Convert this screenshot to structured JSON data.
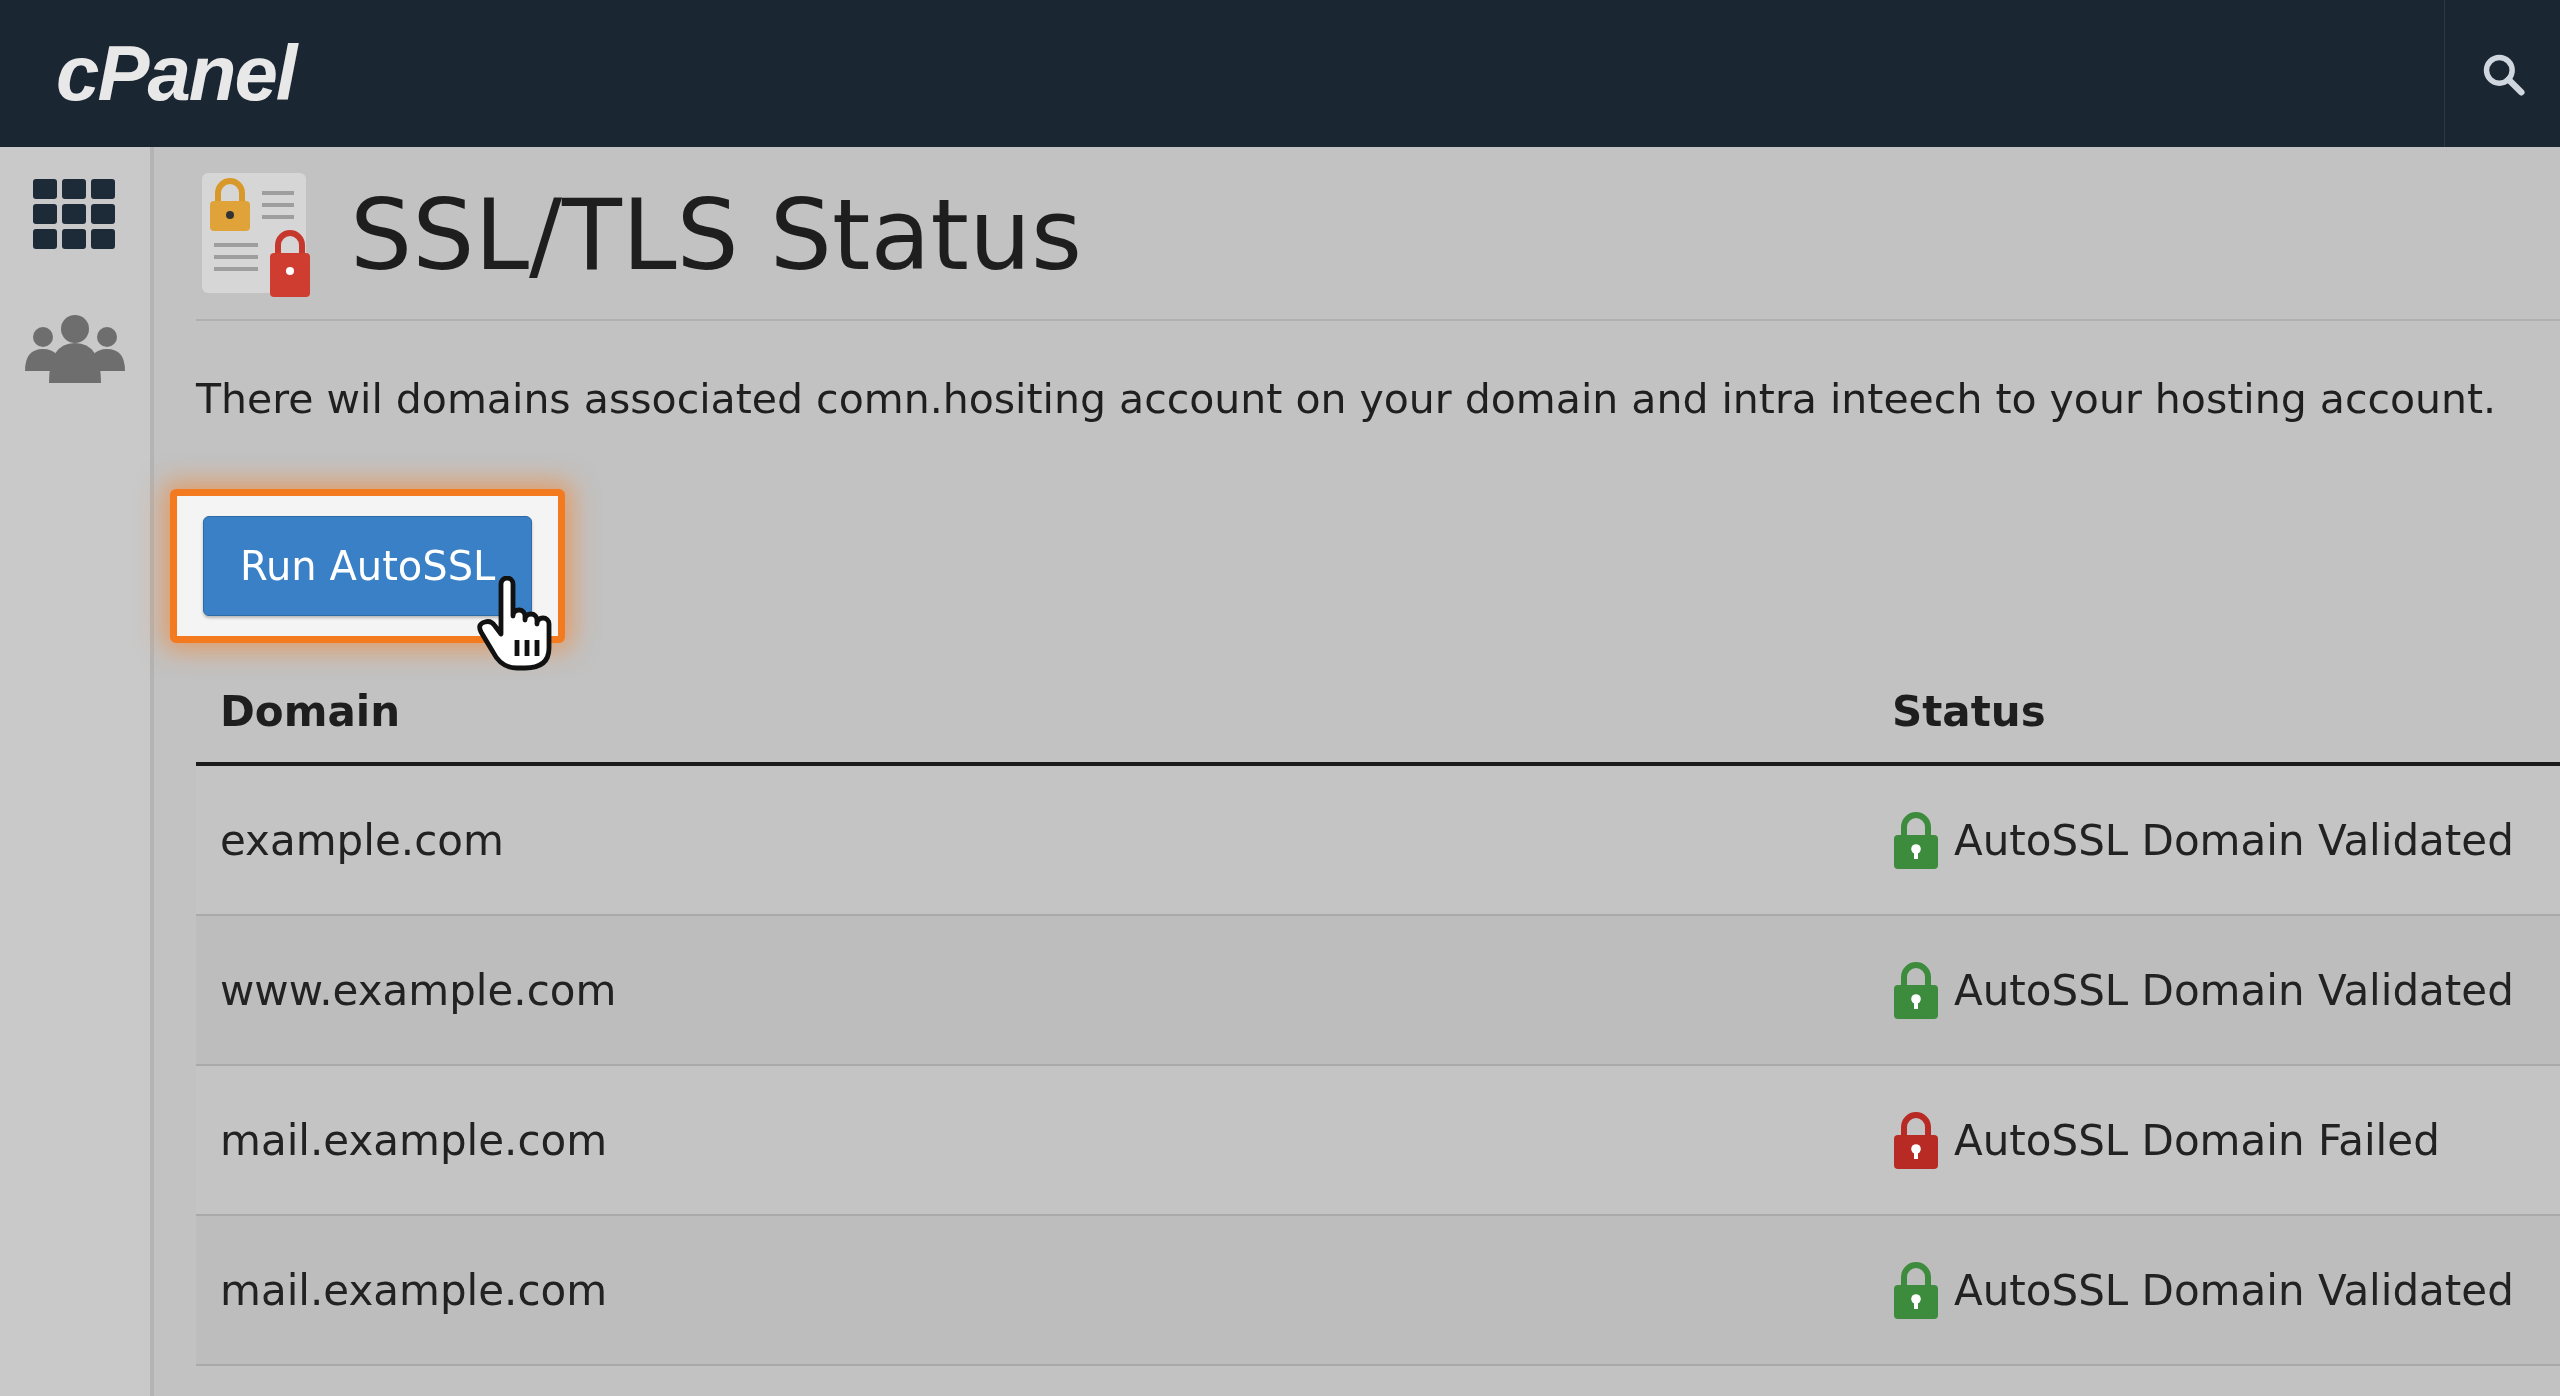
{
  "header": {
    "logo": "cPanel"
  },
  "page": {
    "title": "SSL/TLS Status",
    "description": "There wil domains associated comn.hositing account on your domain and intra inteech to your hosting account.",
    "button": "Run AutoSSL"
  },
  "table": {
    "columns": [
      "Domain",
      "Status"
    ],
    "rows": [
      {
        "domain": "example.com",
        "status": "AutoSSL Domain Validated",
        "kind": "validated"
      },
      {
        "domain": "www.example.com",
        "status": "AutoSSL Domain Validated",
        "kind": "validated"
      },
      {
        "domain": "mail.example.com",
        "status": "AutoSSL Domain Failed",
        "kind": "failed"
      },
      {
        "domain": "mail.example.com",
        "status": "AutoSSL Domain Validated",
        "kind": "validated"
      }
    ]
  }
}
